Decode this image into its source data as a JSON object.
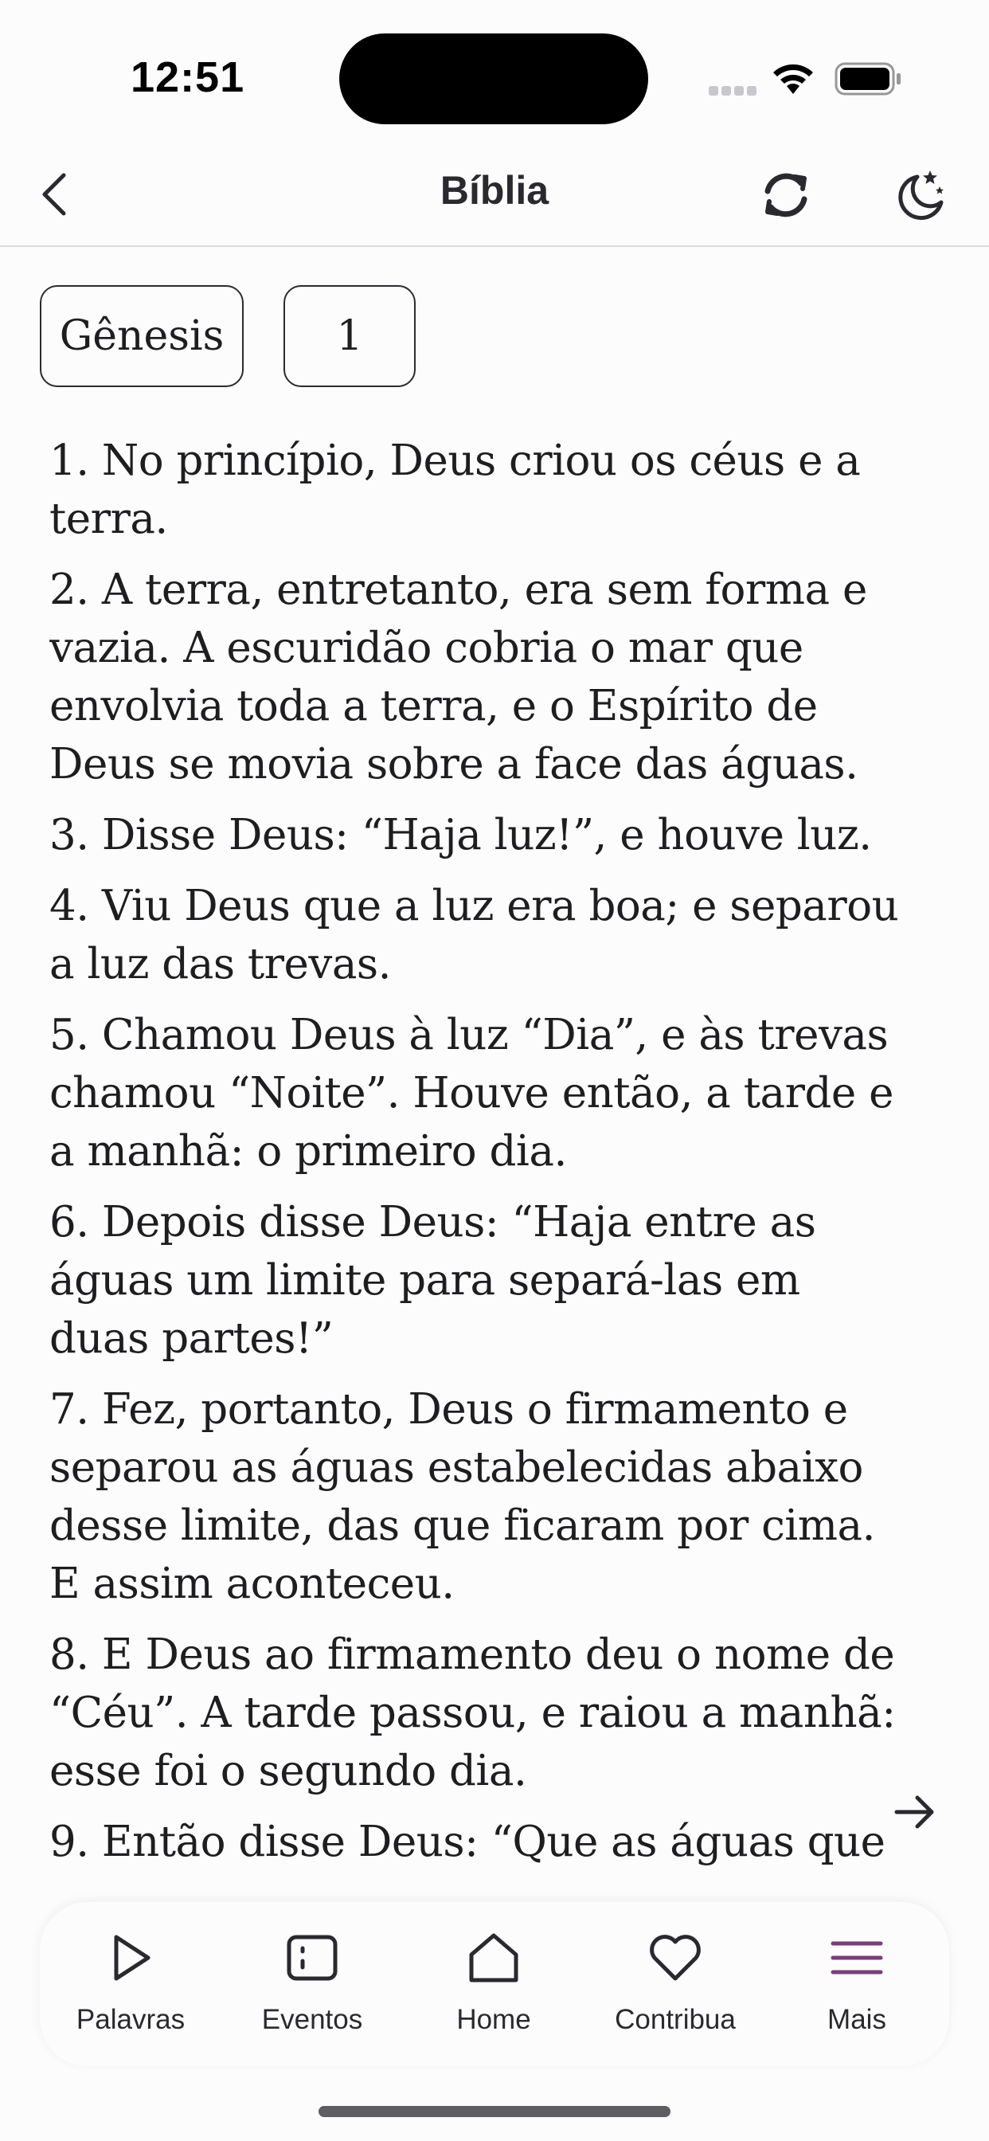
{
  "status": {
    "time": "12:51"
  },
  "header": {
    "title": "Bíblia"
  },
  "selectors": {
    "book": "Gênesis",
    "chapter": "1"
  },
  "verses": [
    "1. No princípio, Deus criou os céus e a terra.",
    "2. A terra, entretanto, era sem forma e vazia. A escuridão cobria o mar que envolvia toda a terra, e o Espírito de Deus se movia sobre a face das águas.",
    "3. Disse Deus: “Haja luz!”, e houve luz.",
    "4. Viu Deus que a luz era boa; e separou a luz das trevas.",
    "5. Chamou Deus à luz “Dia”, e às trevas chamou “Noite”. Houve então, a tarde e a manhã: o primeiro dia.",
    "6. Depois disse Deus: “Haja entre as águas um limite para separá-las em duas partes!”",
    "7. Fez, portanto, Deus o firmamento e separou as águas estabelecidas abaixo desse limite, das que ficaram por cima. E assim aconteceu.",
    "8. E Deus ao firmamento deu o nome de “Céu”. A tarde passou, e raiou a manhã: esse foi o segundo dia.",
    "9. Então disse Deus: “Que as águas que"
  ],
  "tabs": [
    {
      "label": "Palavras",
      "icon": "play-icon"
    },
    {
      "label": "Eventos",
      "icon": "events-icon"
    },
    {
      "label": "Home",
      "icon": "home-icon"
    },
    {
      "label": "Contribua",
      "icon": "heart-icon"
    },
    {
      "label": "Mais",
      "icon": "menu-icon",
      "active": true
    }
  ],
  "colors": {
    "accent": "#7a3d7f",
    "text": "#1e1e20"
  },
  "icons": {
    "back": "chevron-left-icon",
    "sync": "sync-icon",
    "theme": "moon-stars-icon",
    "next": "arrow-right-icon"
  }
}
